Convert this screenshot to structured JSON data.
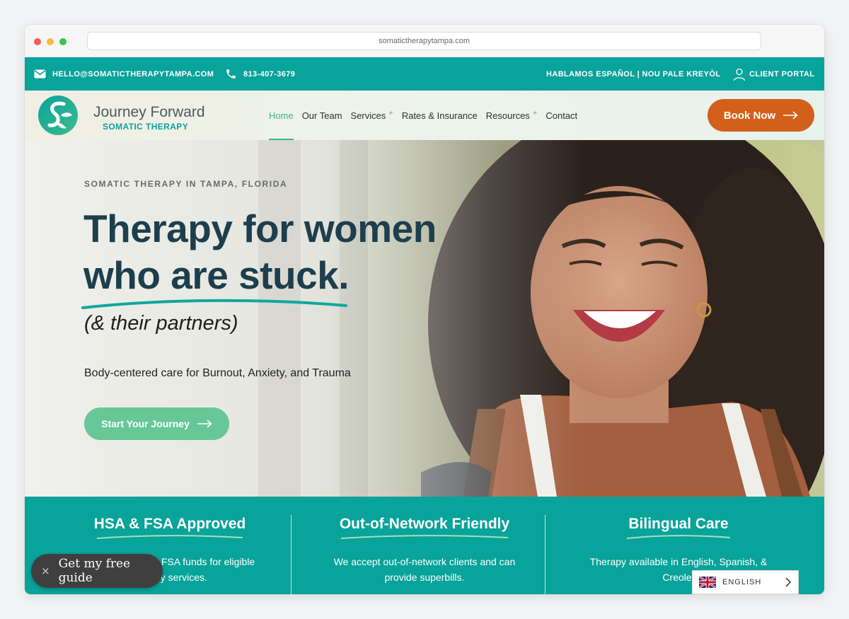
{
  "browser": {
    "url": "somatictherapytampa.com"
  },
  "topbar": {
    "email": "HELLO@SOMATICTHERAPYTAMPA.COM",
    "phone": "813-407-3679",
    "languages_note": "HABLAMOS ESPAÑOL | NOU PALE KREYÒL",
    "client_portal": "CLIENT PORTAL",
    "icons": [
      "envelope-icon",
      "phone-icon",
      "user-icon"
    ]
  },
  "header": {
    "logo_name": "Journey Forward",
    "logo_tagline": "SOMATIC THERAPY",
    "nav": [
      {
        "label": "Home",
        "active": true,
        "has_submenu": false
      },
      {
        "label": "Our Team",
        "active": false,
        "has_submenu": false
      },
      {
        "label": "Services",
        "active": false,
        "has_submenu": true
      },
      {
        "label": "Rates & Insurance",
        "active": false,
        "has_submenu": false
      },
      {
        "label": "Resources",
        "active": false,
        "has_submenu": true
      },
      {
        "label": "Contact",
        "active": false,
        "has_submenu": false
      }
    ],
    "submenu_marker": "+",
    "book_now": "Book Now"
  },
  "hero": {
    "eyebrow": "SOMATIC THERAPY IN TAMPA, FLORIDA",
    "headline_line1": "Therapy for women",
    "headline_line2": "who are stuck.",
    "subheadline": "(& their partners)",
    "description": "Body-centered care for Burnout, Anxiety, and Trauma",
    "cta": "Start Your Journey"
  },
  "features": [
    {
      "title": "HSA & FSA Approved",
      "text": "Use your HSA or FSA funds for eligible therapy services."
    },
    {
      "title": "Out-of-Network Friendly",
      "text": "We accept out-of-network clients and can provide superbills."
    },
    {
      "title": "Bilingual Care",
      "text": "Therapy available in English, Spanish, & Creole."
    }
  ],
  "widgets": {
    "free_guide": "Get my free guide",
    "free_guide_close": "×",
    "language": "ENGLISH"
  },
  "colors": {
    "teal": "#08a39a",
    "navy_heading": "#1d3e4d",
    "book_orange": "#d3601a",
    "cta_green": "#68c797",
    "active_nav": "#3fb58d"
  }
}
